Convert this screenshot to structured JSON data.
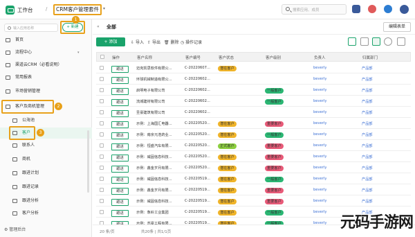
{
  "header": {
    "workbench": "工作台",
    "app_title": "CRM客户管理套件",
    "search_placeholder": "搜索应用、成员"
  },
  "sidebar": {
    "search_placeholder": "输入应用名称",
    "new_label": "+ 新建",
    "items": [
      {
        "label": "首页"
      },
      {
        "label": "流程中心"
      },
      {
        "label": "渠道云CRM（必看说明）"
      },
      {
        "label": "常用报表"
      },
      {
        "label": "市场营销管理"
      },
      {
        "label": "客户及商机管理"
      },
      {
        "label": "公海池"
      },
      {
        "label": "客户"
      },
      {
        "label": "联系人"
      },
      {
        "label": "商机"
      },
      {
        "label": "跟进计划"
      },
      {
        "label": "跟进记录"
      },
      {
        "label": "跟进分析"
      },
      {
        "label": "客户分析"
      }
    ],
    "bottom": "管理后台",
    "badges": [
      "1",
      "2",
      "3"
    ]
  },
  "main": {
    "all_label": "全部",
    "edit_form": "编辑表单",
    "toolbar": {
      "add": "+ 添加",
      "import": "导入",
      "export": "导出",
      "delete": "删除",
      "log": "操作记录"
    },
    "columns": [
      "操作",
      "客户名称",
      "客户编号",
      "客户状态",
      "客户级别",
      "负责人",
      "归属部门"
    ],
    "rows": [
      {
        "op": "跟进",
        "name": "迈克凯思软件有限公...",
        "code": "C-20220607...",
        "status": "潜在客户",
        "status_color": "#f0b429",
        "level": "",
        "level_color": "",
        "owner": "beverly",
        "dept": "产品部"
      },
      {
        "op": "跟进",
        "name": "环球机械制造有限公...",
        "code": "C-20220602...",
        "status": "",
        "status_color": "",
        "level": "",
        "level_color": "",
        "owner": "beverly",
        "dept": "产品部"
      },
      {
        "op": "跟进",
        "name": "启明电子有限公司",
        "code": "C-20220602...",
        "status": "",
        "status_color": "",
        "level": "一般客户",
        "level_color": "#2bb673",
        "owner": "beverly",
        "dept": "产品部"
      },
      {
        "op": "跟进",
        "name": "流城建材有限公司",
        "code": "C-20220602...",
        "status": "",
        "status_color": "",
        "level": "一般客户",
        "level_color": "#2bb673",
        "owner": "beverly",
        "dept": "产品部"
      },
      {
        "op": "跟进",
        "name": "圣豪建筑有限公司",
        "code": "C-20220602...",
        "status": "",
        "status_color": "",
        "level": "",
        "level_color": "",
        "owner": "beverly",
        "dept": "产品部"
      },
      {
        "op": "跟进",
        "name": "示例：上海国汇电器...",
        "code": "C-20220520...",
        "status": "潜在客户",
        "status_color": "#f0b429",
        "level": "重要客户",
        "level_color": "#e85a78",
        "owner": "beverly",
        "dept": "产品部"
      },
      {
        "op": "跟进",
        "name": "示例：南京元浩药业...",
        "code": "C-20220520...",
        "status": "潜在客户",
        "status_color": "#f0b429",
        "level": "一般客户",
        "level_color": "#2bb673",
        "owner": "beverly",
        "dept": "产品部"
      },
      {
        "op": "跟进",
        "name": "示例：恒盛汽车有限...",
        "code": "C-20220520...",
        "status": "正式客户",
        "status_color": "#8ccf3f",
        "level": "重要客户",
        "level_color": "#e85a78",
        "owner": "beverly",
        "dept": "产品部"
      },
      {
        "op": "跟进",
        "name": "示例：威固信息科技...",
        "code": "C-20220520...",
        "status": "潜在客户",
        "status_color": "#f0b429",
        "level": "重要客户",
        "level_color": "#e85a78",
        "owner": "beverly",
        "dept": "产品部"
      },
      {
        "op": "跟进",
        "name": "示例：鑫金岁月有限...",
        "code": "C-20220520...",
        "status": "潜在客户",
        "status_color": "#f0b429",
        "level": "重要客户",
        "level_color": "#e85a78",
        "owner": "beverly",
        "dept": "产品部"
      },
      {
        "op": "跟进",
        "name": "示例：威固信息科技...",
        "code": "C-20220519...",
        "status": "潜在客户",
        "status_color": "#f0b429",
        "level": "一般客户",
        "level_color": "#2bb673",
        "owner": "beverly",
        "dept": "产品部"
      },
      {
        "op": "跟进",
        "name": "示例：鑫金岁月有限...",
        "code": "C-20220519...",
        "status": "潜在客户",
        "status_color": "#f0b429",
        "level": "重要客户",
        "level_color": "#e85a78",
        "owner": "beverly",
        "dept": "产品部"
      },
      {
        "op": "跟进",
        "name": "示例：威固信息科技...",
        "code": "C-20220519...",
        "status": "潜在客户",
        "status_color": "#f0b429",
        "level": "重要客户",
        "level_color": "#e85a78",
        "owner": "beverly",
        "dept": "产品部"
      },
      {
        "op": "跟进",
        "name": "示例：象岭工业集团",
        "code": "C-20220519...",
        "status": "潜在客户",
        "status_color": "#f0b429",
        "level": "一般客户",
        "level_color": "#2bb673",
        "owner": "beverly",
        "dept": "产品部"
      },
      {
        "op": "跟进",
        "name": "示例：苏豪工程有限...",
        "code": "C-20220519...",
        "status": "潜在客户",
        "status_color": "#f0b429",
        "level": "一般客户",
        "level_color": "#2bb673",
        "owner": "beverly",
        "dept": "产品部"
      }
    ],
    "footer": {
      "page_size": "20 条/页",
      "summary": "共20条 | 共1/1页"
    }
  },
  "watermark": "元码手游网",
  "colors": {
    "accent": "#1aa36b",
    "highlight": "#e8a11a",
    "link": "#3b6fd4"
  }
}
